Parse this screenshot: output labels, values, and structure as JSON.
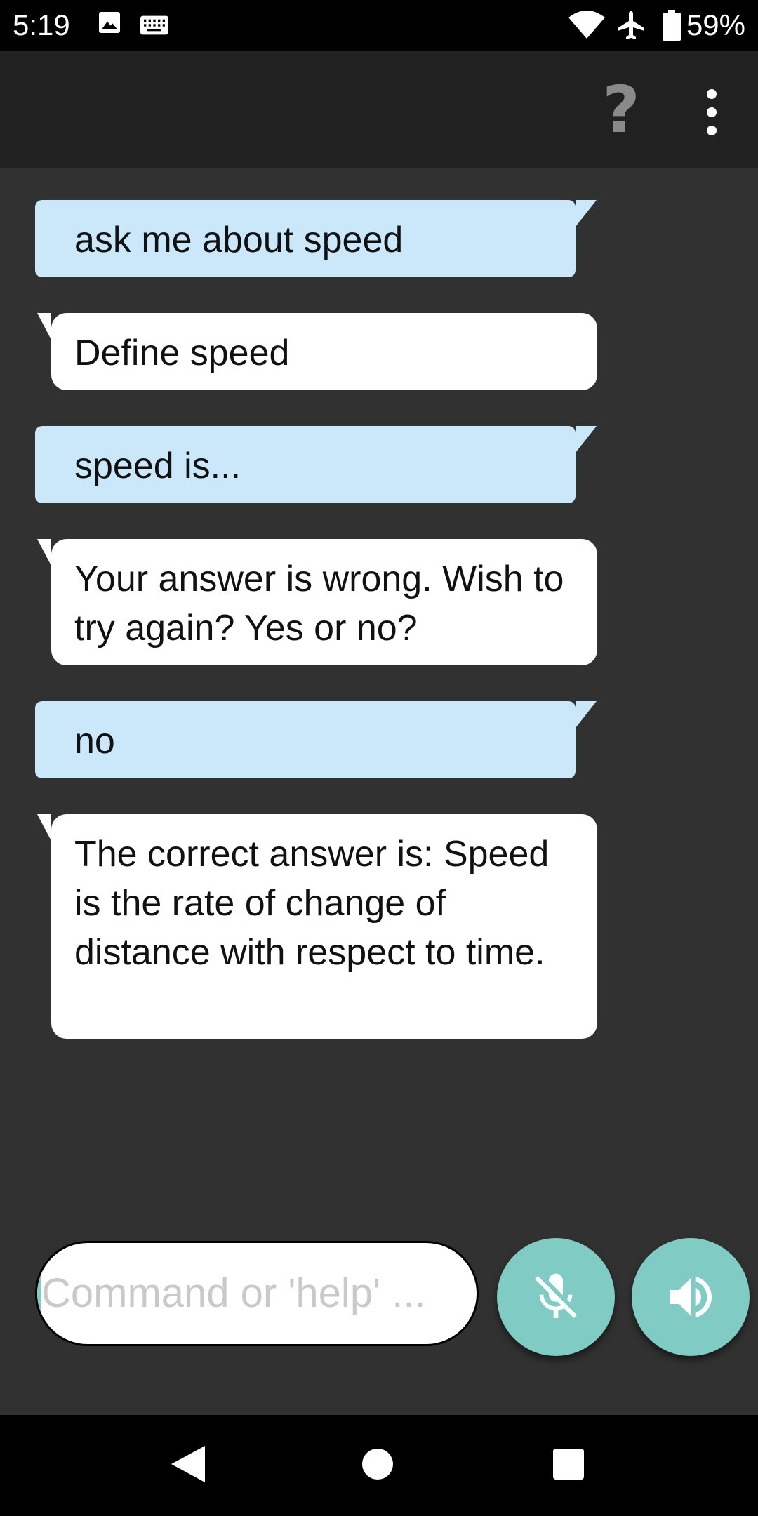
{
  "status_bar": {
    "time": "5:19",
    "battery": "59%",
    "icons": [
      "image-icon",
      "keyboard-icon",
      "wifi-icon",
      "airplane-icon",
      "battery-icon"
    ]
  },
  "app_bar": {
    "help_label": "?",
    "icons": [
      "help-icon",
      "more-vert-icon"
    ]
  },
  "chat": {
    "messages": [
      {
        "sender": "user",
        "text": "ask me about speed"
      },
      {
        "sender": "bot",
        "text": "Define speed"
      },
      {
        "sender": "user",
        "text": "speed is..."
      },
      {
        "sender": "bot",
        "text": "Your answer is wrong. Wish to try again? Yes or no?"
      },
      {
        "sender": "user",
        "text": "no"
      },
      {
        "sender": "bot",
        "text": "The correct answer is: Speed is the rate of change of distance with respect to time."
      }
    ]
  },
  "input": {
    "placeholder": "Command or 'help' ..."
  },
  "buttons": {
    "mic_icon": "mic-off-icon",
    "speaker_icon": "volume-up-icon"
  },
  "colors": {
    "user_bubble": "#cbe8fa",
    "bot_bubble": "#ffffff",
    "background": "#313131",
    "fab": "#80cbc4"
  }
}
